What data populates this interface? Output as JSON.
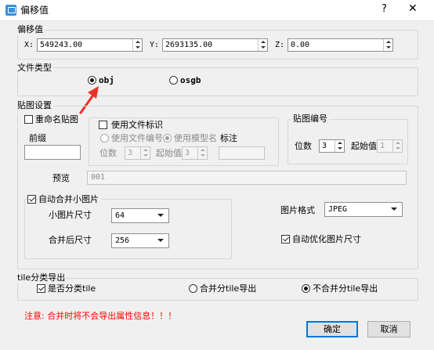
{
  "window": {
    "title": "偏移值",
    "help_glyph": "?",
    "close_glyph": "✕"
  },
  "offset": {
    "group_label": "偏移值",
    "x_label": "X:",
    "x_value": "549243.00",
    "y_label": "Y:",
    "y_value": "2693135.00",
    "z_label": "Z:",
    "z_value": "0.00"
  },
  "file_type": {
    "group_label": "文件类型",
    "obj_label": "obj",
    "obj_selected": true,
    "osgb_label": "osgb",
    "osgb_selected": false
  },
  "texture": {
    "group_label": "贴图设置",
    "rename_label": "重命名贴图",
    "prefix_label": "前缀",
    "prefix_value": "",
    "use_file_id_label": "使用文件标识",
    "use_file_number_label": "使用文件编号",
    "use_model_name_label": "使用模型名",
    "mark_label": "标注",
    "digits_label": "位数",
    "digits_value": "3",
    "start_label": "起始值",
    "start_value": "3",
    "preview_label": "预览",
    "preview_value": "001"
  },
  "texture_number": {
    "group_label": "贴图编号",
    "digits_label": "位数",
    "digits_value": "3",
    "start_label": "起始值",
    "start_value": "1"
  },
  "merge": {
    "auto_merge_label": "自动合并小图片",
    "small_size_label": "小图片尺寸",
    "small_size_value": "64",
    "merged_size_label": "合并后尺寸",
    "merged_size_value": "256",
    "format_label": "图片格式",
    "format_value": "JPEG",
    "auto_optimize_label": "自动优化图片尺寸"
  },
  "tile_export": {
    "group_label": "tile分类导出",
    "classify_label": "是否分类tile",
    "merge_export_label": "合并分tile导出",
    "no_merge_export_label": "不合并分tile导出"
  },
  "warning": "注意: 合并时将不会导出属性信息！！！",
  "buttons": {
    "ok": "确定",
    "cancel": "取消"
  },
  "colors": {
    "warning": "#ff0000",
    "arrow": "#e8312a",
    "accent": "#0078d7"
  }
}
